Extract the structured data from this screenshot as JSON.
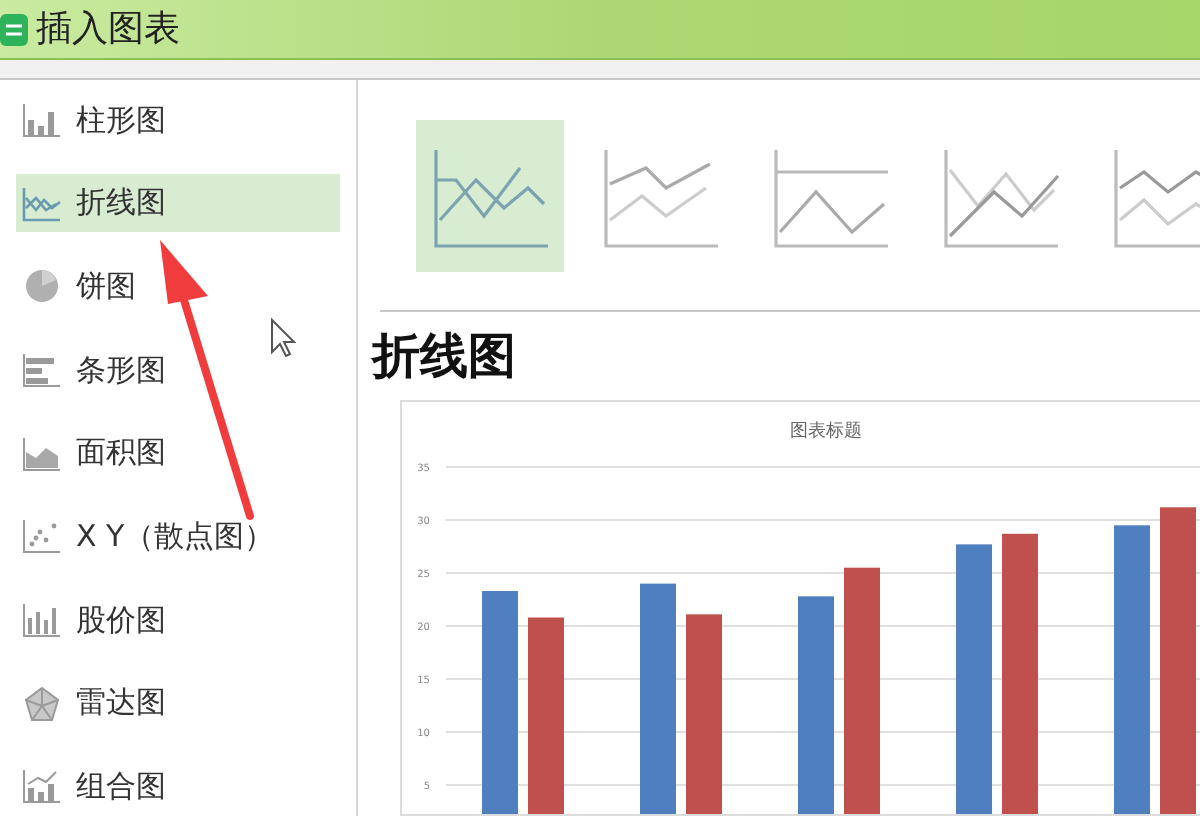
{
  "window": {
    "title": "插入图表"
  },
  "sidebar": {
    "items": [
      {
        "kind": "column",
        "label": "柱形图",
        "selected": false
      },
      {
        "kind": "line",
        "label": "折线图",
        "selected": true
      },
      {
        "kind": "pie",
        "label": "饼图",
        "selected": false
      },
      {
        "kind": "bar",
        "label": "条形图",
        "selected": false
      },
      {
        "kind": "area",
        "label": "面积图",
        "selected": false
      },
      {
        "kind": "scatter",
        "label": "X Y（散点图）",
        "selected": false
      },
      {
        "kind": "stock",
        "label": "股价图",
        "selected": false
      },
      {
        "kind": "radar",
        "label": "雷达图",
        "selected": false
      },
      {
        "kind": "combo",
        "label": "组合图",
        "selected": false
      }
    ]
  },
  "subtypes": [
    {
      "selected": true
    },
    {
      "selected": false
    },
    {
      "selected": false
    },
    {
      "selected": false
    },
    {
      "selected": false
    }
  ],
  "preview": {
    "heading": "折线图",
    "chart_data": {
      "type": "bar",
      "title": "图表标题",
      "grid": true,
      "series": [
        {
          "color": "#4f7fbe",
          "values": [
            23.3,
            24,
            22.8,
            27.7,
            29.5
          ]
        },
        {
          "color": "#c0504d",
          "values": [
            20.8,
            21.1,
            25.5,
            28.7,
            31.2
          ]
        }
      ],
      "ylim": [
        0,
        35
      ],
      "yticks": [
        5,
        10,
        15,
        20,
        25,
        30,
        35
      ]
    }
  }
}
